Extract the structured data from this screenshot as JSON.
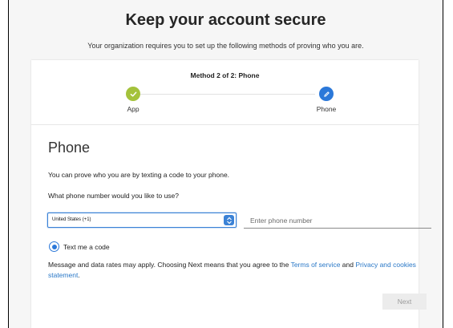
{
  "header": {
    "title": "Keep your account secure",
    "subtitle": "Your organization requires you to set up the following methods of proving who you are."
  },
  "progress": {
    "method_label": "Method 2 of 2: Phone",
    "steps": [
      {
        "label": "App",
        "state": "complete",
        "color": "#a4c23b",
        "icon": "checkmark-icon"
      },
      {
        "label": "Phone",
        "state": "current",
        "color": "#2b78d9",
        "icon": "pencil-icon"
      }
    ]
  },
  "section": {
    "title": "Phone",
    "description": "You can prove who you are by texting a code to your phone.",
    "question": "What phone number would you like to use?"
  },
  "form": {
    "country_selected": "United States (+1)",
    "phone_placeholder": "Enter phone number",
    "radio_label": "Text me a code",
    "radio_checked": true
  },
  "disclaimer": {
    "text": "Message and data rates may apply. Choosing Next means that you agree to the ",
    "terms_link": "Terms of service",
    "and_text": " and ",
    "privacy_link": "Privacy and cookies statement",
    "end": "."
  },
  "actions": {
    "next_label": "Next"
  },
  "colors": {
    "accent": "#2b78d9",
    "complete": "#a4c23b",
    "link": "#2a78c7"
  }
}
